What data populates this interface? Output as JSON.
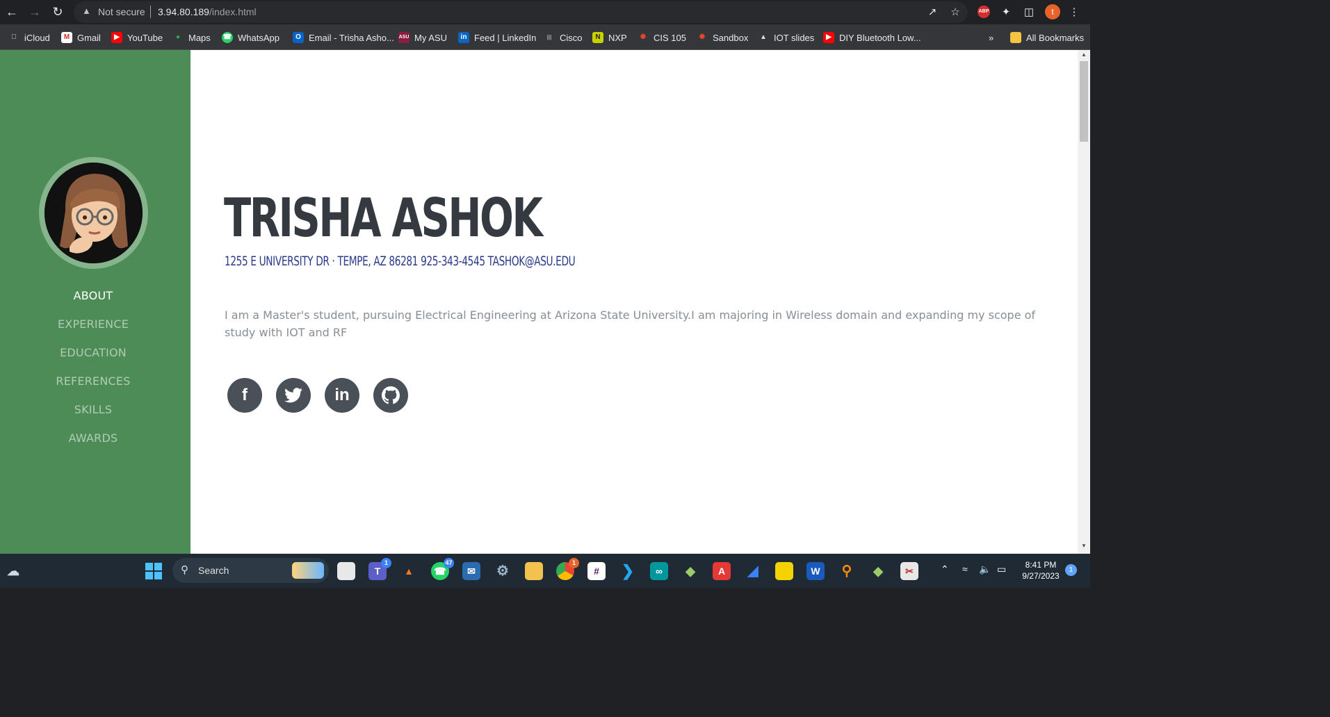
{
  "browser": {
    "security_label": "Not secure",
    "url_host": "3.94.80.189",
    "url_path": "/index.html",
    "profile_initial": "t",
    "abp_label": "ABP",
    "bookmarks": [
      {
        "label": "iCloud",
        "icon": "apple-icon"
      },
      {
        "label": "Gmail",
        "icon": "gmail-icon"
      },
      {
        "label": "YouTube",
        "icon": "youtube-icon"
      },
      {
        "label": "Maps",
        "icon": "maps-pin-icon"
      },
      {
        "label": "WhatsApp",
        "icon": "whatsapp-icon"
      },
      {
        "label": "Email - Trisha Asho...",
        "icon": "outlook-icon"
      },
      {
        "label": "My ASU",
        "icon": "asu-icon"
      },
      {
        "label": "Feed | LinkedIn",
        "icon": "linkedin-icon"
      },
      {
        "label": "Cisco",
        "icon": "cisco-icon"
      },
      {
        "label": "NXP",
        "icon": "nxp-icon"
      },
      {
        "label": "CIS 105",
        "icon": "canvas-icon"
      },
      {
        "label": "Sandbox",
        "icon": "canvas-icon"
      },
      {
        "label": "IOT slides",
        "icon": "slides-icon"
      },
      {
        "label": "DIY Bluetooth Low...",
        "icon": "youtube-icon"
      }
    ],
    "overflow_label": "»",
    "all_bookmarks_label": "All Bookmarks"
  },
  "sidebar": {
    "nav": [
      "ABOUT",
      "EXPERIENCE",
      "EDUCATION",
      "REFERENCES",
      "SKILLS",
      "AWARDS"
    ],
    "active": "ABOUT"
  },
  "about": {
    "name": "TRISHA ASHOK",
    "contact": "1255 E UNIVERSITY DR · TEMPE, AZ 86281 925-343-4545 TASHOK@ASU.EDU",
    "bio": "I am a Master's student, pursuing Electrical Engineering at Arizona State University.I am majoring in Wireless domain and expanding my scope of study with IOT and RF",
    "social": [
      "facebook-icon",
      "twitter-icon",
      "linkedin-icon",
      "github-icon"
    ]
  },
  "taskbar": {
    "search_label": "Search",
    "badges": {
      "teams": "1",
      "whatsapp": "47",
      "chrome": "1"
    },
    "time": "8:41 PM",
    "date": "9/27/2023",
    "notifications": "1"
  },
  "colors": {
    "sidebar": "#4e8c57",
    "heading": "#343a40",
    "contact": "#2a3a8c",
    "body_text": "#868e96",
    "social_bg": "#495057"
  }
}
